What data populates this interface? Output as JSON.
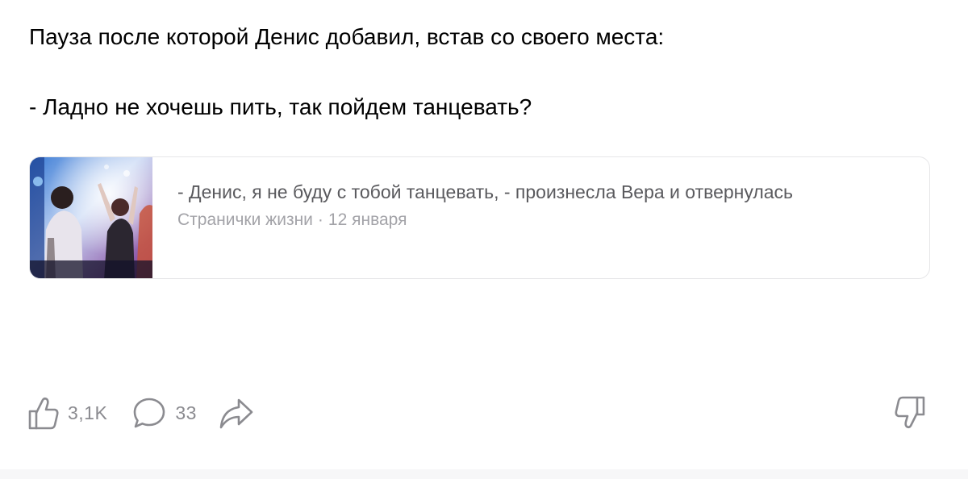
{
  "article": {
    "paragraph_1": "Пауза после которой Денис добавил, встав со своего места:",
    "paragraph_2": "- Ладно не хочешь пить, так пойдем танцевать?"
  },
  "link_card": {
    "title": "- Денис, я не буду с тобой танцевать, - произнесла Вера и отвернулась",
    "source": "Странички жизни",
    "separator": "·",
    "date": "12 января",
    "thumbnail_icon": "party-photo"
  },
  "actions": {
    "like_icon": "thumbs-up-icon",
    "like_count": "3,1K",
    "comment_icon": "comment-bubble-icon",
    "comment_count": "33",
    "share_icon": "share-arrow-icon",
    "dislike_icon": "thumbs-down-icon"
  },
  "colors": {
    "text_primary": "#000000",
    "text_secondary": "#5a5a5e",
    "text_muted": "#a3a3a8",
    "icon_gray": "#8b8b90",
    "card_border": "#e6e6e8"
  }
}
